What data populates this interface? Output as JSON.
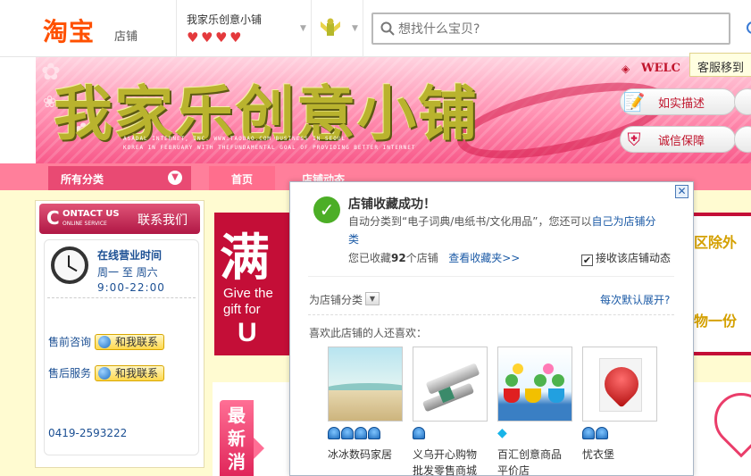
{
  "header": {
    "logo_text": "淘宝",
    "logo_sub": "店铺",
    "shop_name": "我家乐创意小铺",
    "hearts": [
      "♥",
      "♥",
      "♥",
      "♥"
    ],
    "search_placeholder": "想找什么宝贝?"
  },
  "banner": {
    "title": "我家乐创意小铺",
    "subline1": "ASADAL INTERNET, INC. WWW.TAOBAO.COM BUSINESS IN SEOUL",
    "subline2": "KOREA IN FEBRUARY  WITH THEFUNDAMENTAL GOAL OF PROVIDING BETTER INTERNET",
    "welcome": "WELC",
    "btn_describe": "如实描述",
    "btn_guarantee": "诚信保障"
  },
  "tooltip": "客服移到",
  "nav": {
    "all_categories": "所有分类",
    "home": "首页",
    "shop_news": "店铺动态"
  },
  "sidebar": {
    "contact_big": "C",
    "contact_en1": "ONTACT US",
    "contact_en2": "ONLINE SERVICE",
    "contact_cn": "联系我们",
    "hours_title": "在线营业时间",
    "hours_days": "周一 至 周六",
    "hours_time": "9:00-22:00",
    "presale_label": "售前咨询",
    "aftersale_label": "售后服务",
    "contact_btn": "和我联系",
    "phone": "0419-2593222"
  },
  "promo": {
    "man": "满",
    "give_line1": "Give the",
    "give_line2": "gift for",
    "u": "U",
    "right_line1": "区除外",
    "right_line2": "物一份",
    "new_sale": "最新消"
  },
  "popup": {
    "title": "店铺收藏成功！",
    "line1_prefix": "自动分类到“电子词典/电纸书/文化用品”，您还可以",
    "line1_link": "自己为店铺分",
    "line2_link": "类",
    "count_prefix": "您已收藏",
    "count_value": "92",
    "count_suffix": "个店铺",
    "view_favorites": "查看收藏夹>>",
    "receive_updates": "接收该店铺动态",
    "receive_checked": "✔",
    "classify_label": "为店铺分类",
    "expand_link": "每次默认展开?",
    "also_like": "喜欢此店铺的人还喜欢：",
    "shops": [
      {
        "name": "冰冰数码家居",
        "level": "4 crowns"
      },
      {
        "name": "义乌开心购物批发零售商城",
        "level": "1 crown"
      },
      {
        "name": "百汇创意商品平价店",
        "level": "1 diamond"
      },
      {
        "name": "忧衣堡",
        "level": "2 crowns"
      }
    ]
  },
  "colors": {
    "taobao_orange": "#ff5000",
    "nav_pink": "#ff7f9b",
    "link_blue": "#1b5aa6",
    "promo_red": "#c40e37",
    "content_bg": "#fffbd1"
  }
}
